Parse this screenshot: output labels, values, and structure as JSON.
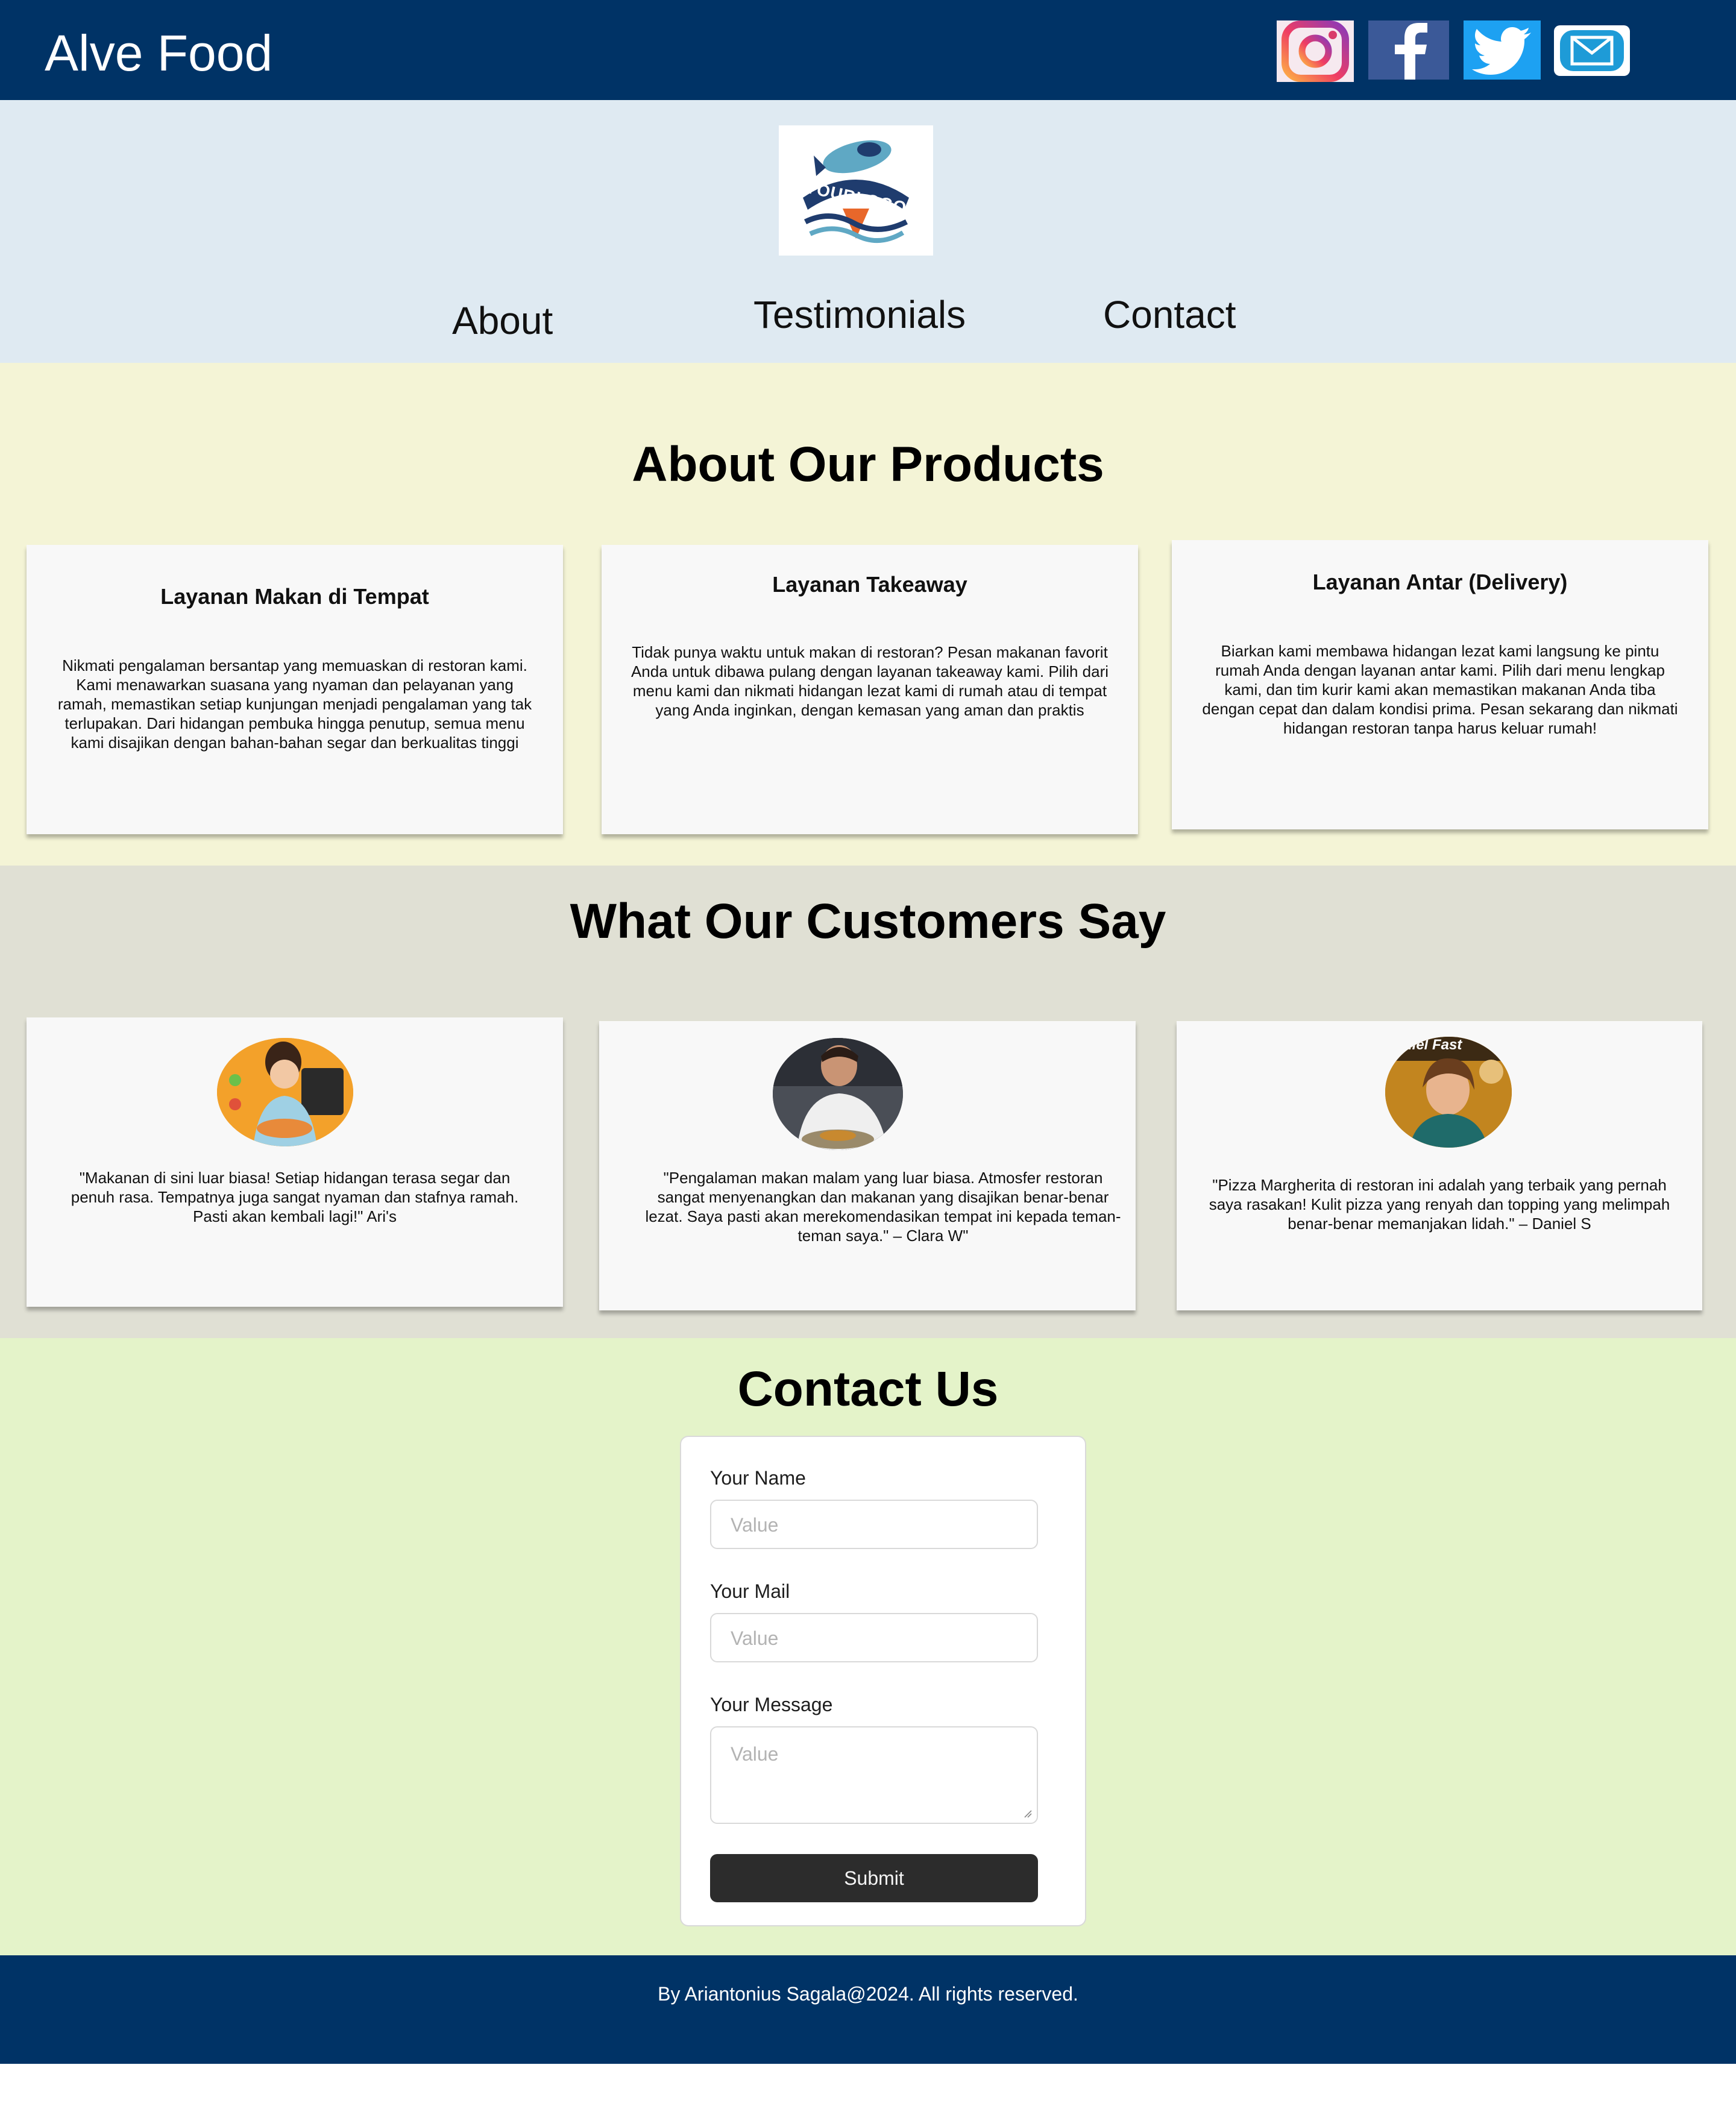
{
  "header": {
    "brand": "Alve Food",
    "social_icons": [
      "instagram-icon",
      "facebook-icon",
      "twitter-icon",
      "mail-icon"
    ]
  },
  "logo": {
    "text": "YOURLOGO"
  },
  "nav": {
    "about": "About",
    "testimonials": "Testimonials",
    "contact": "Contact"
  },
  "about": {
    "title": "About Our Products",
    "cards": [
      {
        "title": "Layanan Makan di Tempat",
        "lines": [
          "Nikmati pengalaman bersantap yang memuaskan di restoran kami.",
          "Kami menawarkan suasana yang nyaman dan pelayanan yang",
          "ramah, memastikan setiap kunjungan menjadi pengalaman yang tak",
          "terlupakan. Dari hidangan pembuka hingga penutup, semua menu",
          "kami disajikan dengan bahan-bahan segar dan berkualitas tinggi"
        ]
      },
      {
        "title": "Layanan Takeaway",
        "lines": [
          "Tidak punya waktu untuk makan di restoran? Pesan makanan favorit",
          "Anda untuk dibawa pulang dengan layanan takeaway kami. Pilih dari",
          "menu kami dan nikmati hidangan lezat kami di rumah atau di tempat",
          "yang Anda inginkan, dengan kemasan yang aman dan praktis"
        ]
      },
      {
        "title": "Layanan Antar (Delivery)",
        "lines": [
          "Biarkan kami membawa hidangan lezat kami langsung ke pintu",
          "rumah Anda dengan layanan antar kami. Pilih dari menu lengkap",
          "kami, dan tim kurir kami akan memastikan makanan Anda tiba",
          "dengan cepat dan dalam kondisi prima. Pesan sekarang dan nikmati",
          "hidangan restoran tanpa harus keluar rumah!"
        ]
      }
    ]
  },
  "testimonials": {
    "title": "What Our Customers Say",
    "items": [
      {
        "lines": [
          "\"Makanan di sini luar biasa! Setiap hidangan terasa segar dan",
          "penuh rasa. Tempatnya juga sangat nyaman dan stafnya ramah.",
          "Pasti akan kembali lagi!\" Ari's"
        ]
      },
      {
        "lines": [
          "\"Pengalaman makan malam yang luar biasa. Atmosfer restoran",
          "sangat menyenangkan dan makanan yang disajikan benar-benar",
          "lezat. Saya pasti akan merekomendasikan tempat ini kepada teman-",
          "teman saya.\" – Clara W\""
        ]
      },
      {
        "avatar_caption": "niel Fast",
        "lines": [
          "\"Pizza Margherita di restoran ini adalah yang terbaik yang pernah",
          "saya rasakan! Kulit pizza yang renyah dan topping yang melimpah",
          "benar-benar memanjakan lidah.\" – Daniel S"
        ]
      }
    ]
  },
  "contact": {
    "title": "Contact Us",
    "name_label": "Your Name",
    "name_placeholder": "Value",
    "mail_label": "Your Mail",
    "mail_placeholder": "Value",
    "message_label": "Your Message",
    "message_placeholder": "Value",
    "submit_label": "Submit"
  },
  "footer": {
    "text": "By Ariantonius Sagala@2024. All rights reserved."
  },
  "colors": {
    "header_bg": "#003366",
    "nav_bg": "#dfeaf2",
    "about_bg": "#f4f4d6",
    "testimonials_bg": "#e0e0d4",
    "contact_bg": "#e4f3c9",
    "button_bg": "#2c2c2c"
  }
}
